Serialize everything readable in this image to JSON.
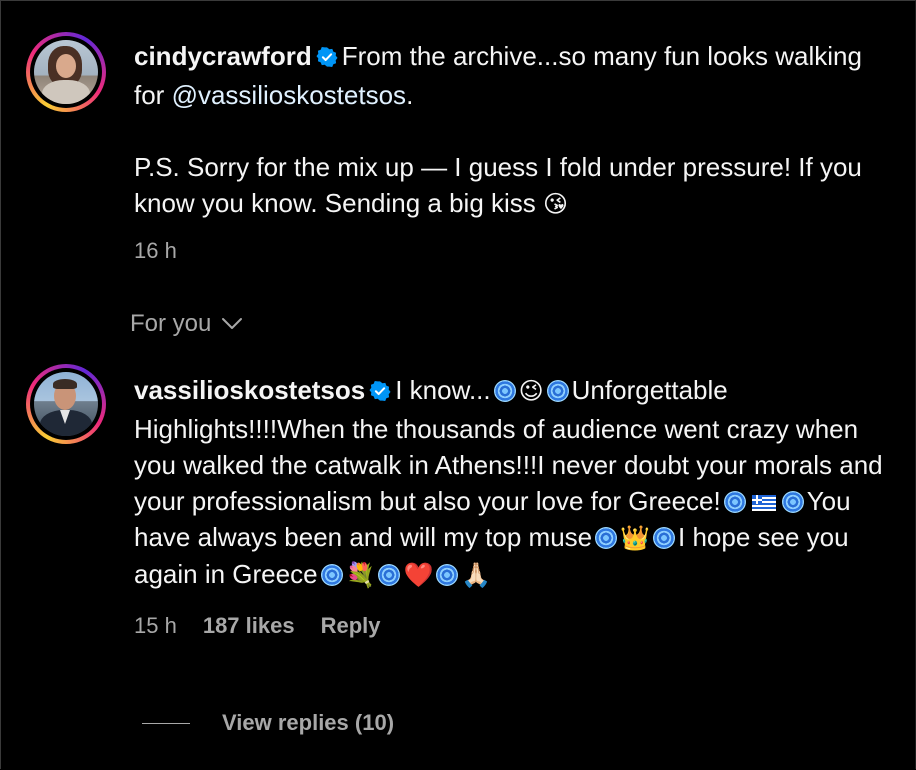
{
  "comments": [
    {
      "username": "cindycrawford",
      "verified": true,
      "text_parts": {
        "p1": "From the archive...so many fun looks walking for ",
        "mention": "@vassilioskostetsos",
        "p2": ".\n\nP.S. Sorry for the mix up — I guess I fold under pressure! If you know you know. Sending a big kiss ",
        "emoji_end": "😘"
      },
      "time": "16 h"
    },
    {
      "username": "vassilioskostetsos",
      "verified": true,
      "text_parts": {
        "t1": "I know...",
        "e_wink": "😉",
        "t2": "Unforgettable Highlights!!!!When the thousands of audience went crazy when you walked the catwalk in Athens!!!I never doubt your morals and your professionalism but also your love for Greece!",
        "t3": "You have always been and will my top muse",
        "e_crown": "👑",
        "t4": "I hope see you again in Greece",
        "e_bouquet": "💐",
        "e_heart": "❤️",
        "e_pray": "🙏🏻"
      },
      "time": "15 h",
      "likes": "187 likes",
      "reply_label": "Reply",
      "view_replies": "View replies (10)"
    }
  ],
  "section_label": "For you",
  "colors": {
    "background": "#000000",
    "text": "#f5f5f5",
    "muted": "#a8a8a8",
    "verified_badge": "#0095f6"
  },
  "icons": {
    "verified": "verified-badge-icon",
    "chevron": "chevron-down-icon",
    "swirl": "cyclone-emoji-icon",
    "flag": "greece-flag-icon"
  }
}
